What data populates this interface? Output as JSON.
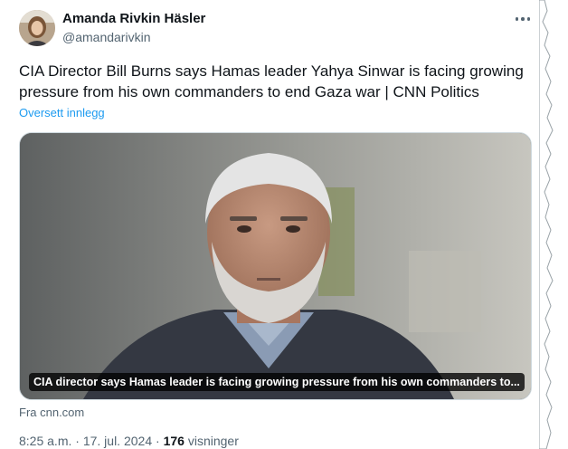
{
  "author": {
    "display_name": "Amanda Rivkin Häsler",
    "handle": "@amandarivkin"
  },
  "tweet": {
    "text": "CIA Director Bill Burns says Hamas leader Yahya Sinwar is facing growing pressure from his own commanders to end Gaza war | CNN Politics",
    "translate_label": "Oversett innlegg"
  },
  "link_card": {
    "caption": "CIA director says Hamas leader is facing growing pressure from his own commanders to...",
    "source": "Fra cnn.com"
  },
  "meta": {
    "time": "8:25 a.m.",
    "separator": "·",
    "date": "17. jul. 2024",
    "views_count": "176",
    "views_label": "visninger"
  },
  "icons": {
    "more": "more-horizontal-icon"
  },
  "colors": {
    "link": "#1d9bf0",
    "secondary_text": "#536471",
    "primary_text": "#0f1419"
  }
}
